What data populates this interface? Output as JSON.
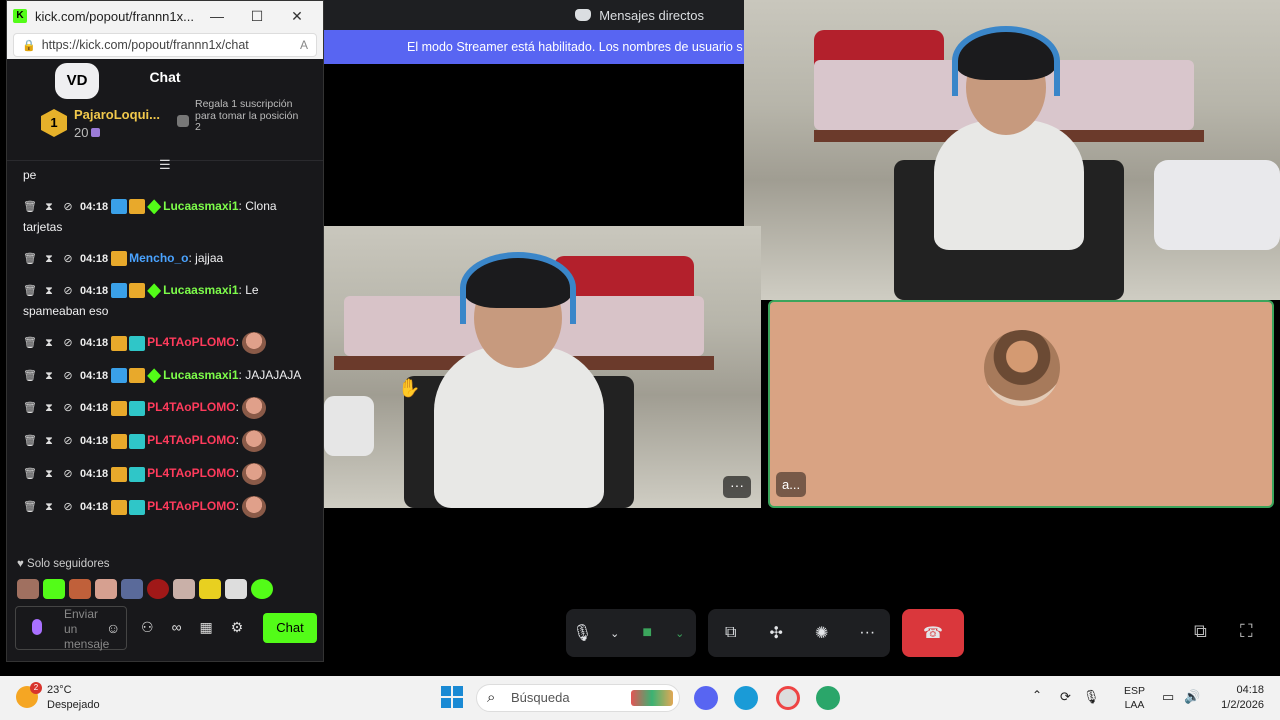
{
  "discord": {
    "title": "Mensajes directos",
    "streamer_banner": "El modo Streamer está habilitado. Los nombres de usuario s",
    "participant_tag": "a...",
    "more_label": "···"
  },
  "kick": {
    "window_title": "kick.com/popout/frannn1x...",
    "url": "https://kick.com/popout/frannn1x/chat",
    "chat_title": "Chat",
    "logo_text": "VD",
    "leaderboard": {
      "rank": "1",
      "name": "PajaroLoqui...",
      "count": "20",
      "gift_text": "Regala 1 suscripción para tomar la posición 2"
    },
    "messages": [
      {
        "time": "",
        "badges": [],
        "user": "",
        "user_color": "#efeff1",
        "text": "pe",
        "emote": false
      },
      {
        "time": "04:18",
        "badges": [
          "mod",
          "crown",
          "vip"
        ],
        "user": "Lucaasmaxi1",
        "user_color": "#7dfc4a",
        "text": "Clona tarjetas",
        "emote": false
      },
      {
        "time": "04:18",
        "badges": [
          "crown"
        ],
        "user": "Mencho_o",
        "user_color": "#4aa3ff",
        "text": "jajjaa",
        "emote": false
      },
      {
        "time": "04:18",
        "badges": [
          "mod",
          "crown",
          "vip"
        ],
        "user": "Lucaasmaxi1",
        "user_color": "#7dfc4a",
        "text": "Le spameaban eso",
        "emote": false
      },
      {
        "time": "04:18",
        "badges": [
          "crown",
          "og"
        ],
        "user": "PL4TAoPLOMO",
        "user_color": "#ff3b5c",
        "text": "",
        "emote": true
      },
      {
        "time": "04:18",
        "badges": [
          "mod",
          "crown",
          "vip"
        ],
        "user": "Lucaasmaxi1",
        "user_color": "#7dfc4a",
        "text": "JAJAJAJA",
        "emote": false
      },
      {
        "time": "04:18",
        "badges": [
          "crown",
          "og"
        ],
        "user": "PL4TAoPLOMO",
        "user_color": "#ff3b5c",
        "text": "",
        "emote": true
      },
      {
        "time": "04:18",
        "badges": [
          "crown",
          "og"
        ],
        "user": "PL4TAoPLOMO",
        "user_color": "#ff3b5c",
        "text": "",
        "emote": true
      },
      {
        "time": "04:18",
        "badges": [
          "crown",
          "og"
        ],
        "user": "PL4TAoPLOMO",
        "user_color": "#ff3b5c",
        "text": "",
        "emote": true
      },
      {
        "time": "04:18",
        "badges": [
          "crown",
          "og"
        ],
        "user": "PL4TAoPLOMO",
        "user_color": "#ff3b5c",
        "text": "",
        "emote": true
      }
    ],
    "followers_only": "Solo seguidores",
    "input_placeholder": "Enviar un mensaje",
    "send_label": "Chat"
  },
  "taskbar": {
    "weather_temp": "23°C",
    "weather_desc": "Despejado",
    "weather_badge": "2",
    "search_placeholder": "Búsqueda",
    "lang_line1": "ESP",
    "lang_line2": "LAA",
    "time": "04:18",
    "date": "1/2/2026"
  },
  "colors": {
    "kick_green": "#53fc18",
    "discord_blurple": "#5865f2",
    "hangup_red": "#da373c",
    "speaking_border": "#3ba55c"
  }
}
